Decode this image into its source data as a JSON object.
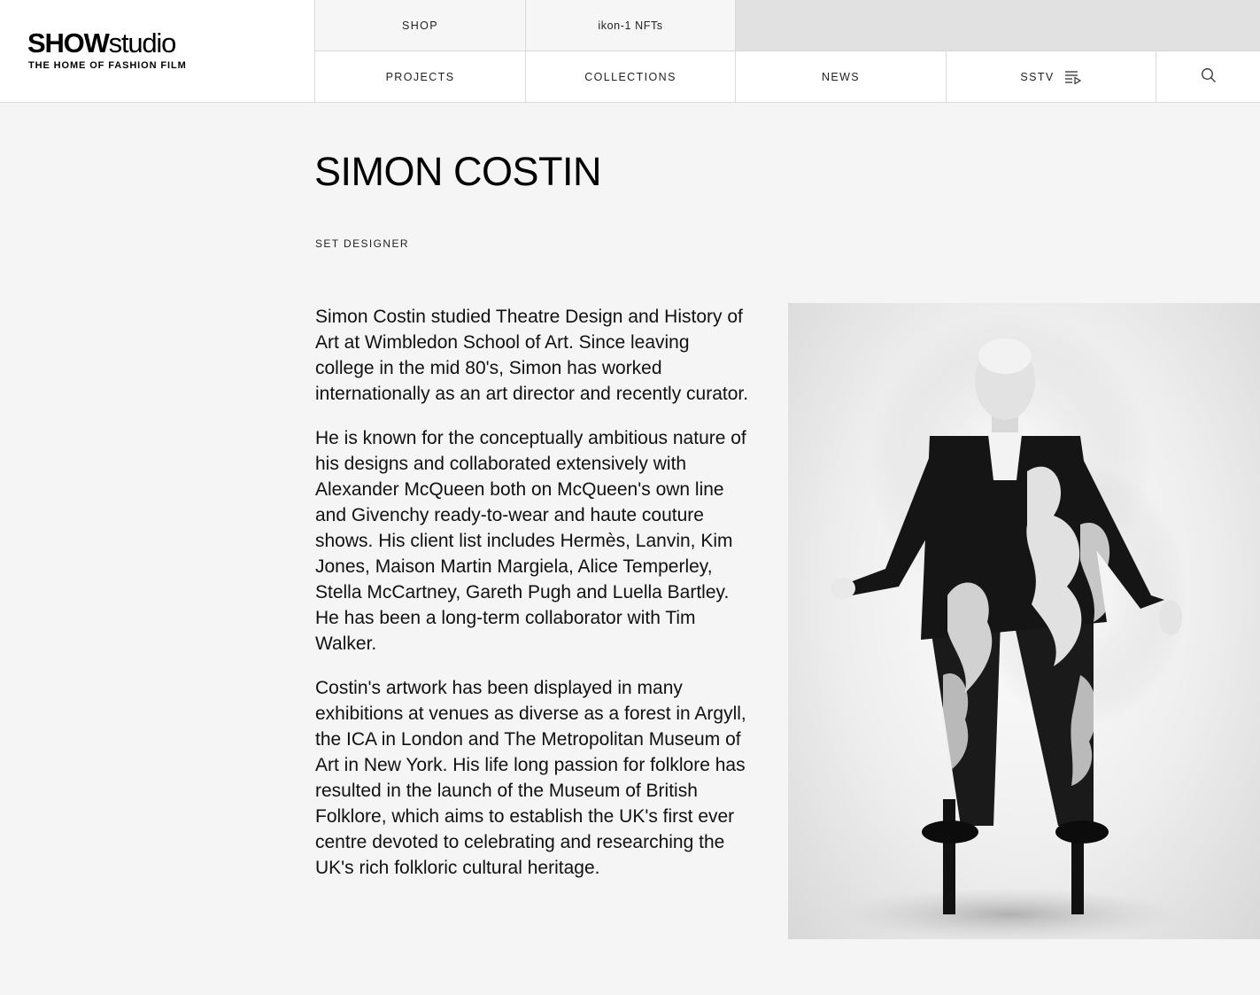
{
  "logo": {
    "bold": "SHOW",
    "light": "studio",
    "tagline": "THE HOME OF FASHION FILM"
  },
  "nav": {
    "top": [
      {
        "label": "SHOP"
      },
      {
        "label": "ikon-1 NFTs"
      }
    ],
    "bottom": [
      {
        "label": "PROJECTS"
      },
      {
        "label": "COLLECTIONS"
      },
      {
        "label": "NEWS"
      },
      {
        "label": "SSTV",
        "icon": "playlist-icon"
      },
      {
        "icon": "search-icon"
      }
    ]
  },
  "profile": {
    "name": "SIMON COSTIN",
    "role": "SET DESIGNER",
    "bio": [
      "Simon Costin studied Theatre Design and History of Art at Wimbledon School of Art. Since leaving college in the mid 80's, Simon has worked internationally as an art director and recently curator.",
      "He is known for the conceptually ambitious nature of his designs and collaborated extensively with Alexander McQueen both on McQueen's own line and Givenchy ready-to-wear and haute couture shows. His client list includes Hermès, Lanvin, Kim Jones, Maison Martin Margiela, Alice Temperley, Stella McCartney, Gareth Pugh and Luella Bartley. He has been a long-term collaborator with Tim Walker.",
      "Costin's artwork has been displayed in many exhibitions at venues as diverse as a forest in Argyll, the ICA in London and The Metropolitan Museum of Art in New York. His life long passion for folklore has resulted in the launch of the Museum of British Folklore, which aims to establish the UK's first ever centre devoted to celebrating and researching the UK's rich folkloric cultural heritage."
    ]
  },
  "colors": {
    "page_background": "#f5f5f5",
    "header_background": "#ffffff",
    "nav_top_background": "#f6f6f6",
    "nav_filler": "#e1e1e1",
    "border": "#d9d9d9",
    "text": "#111111"
  }
}
